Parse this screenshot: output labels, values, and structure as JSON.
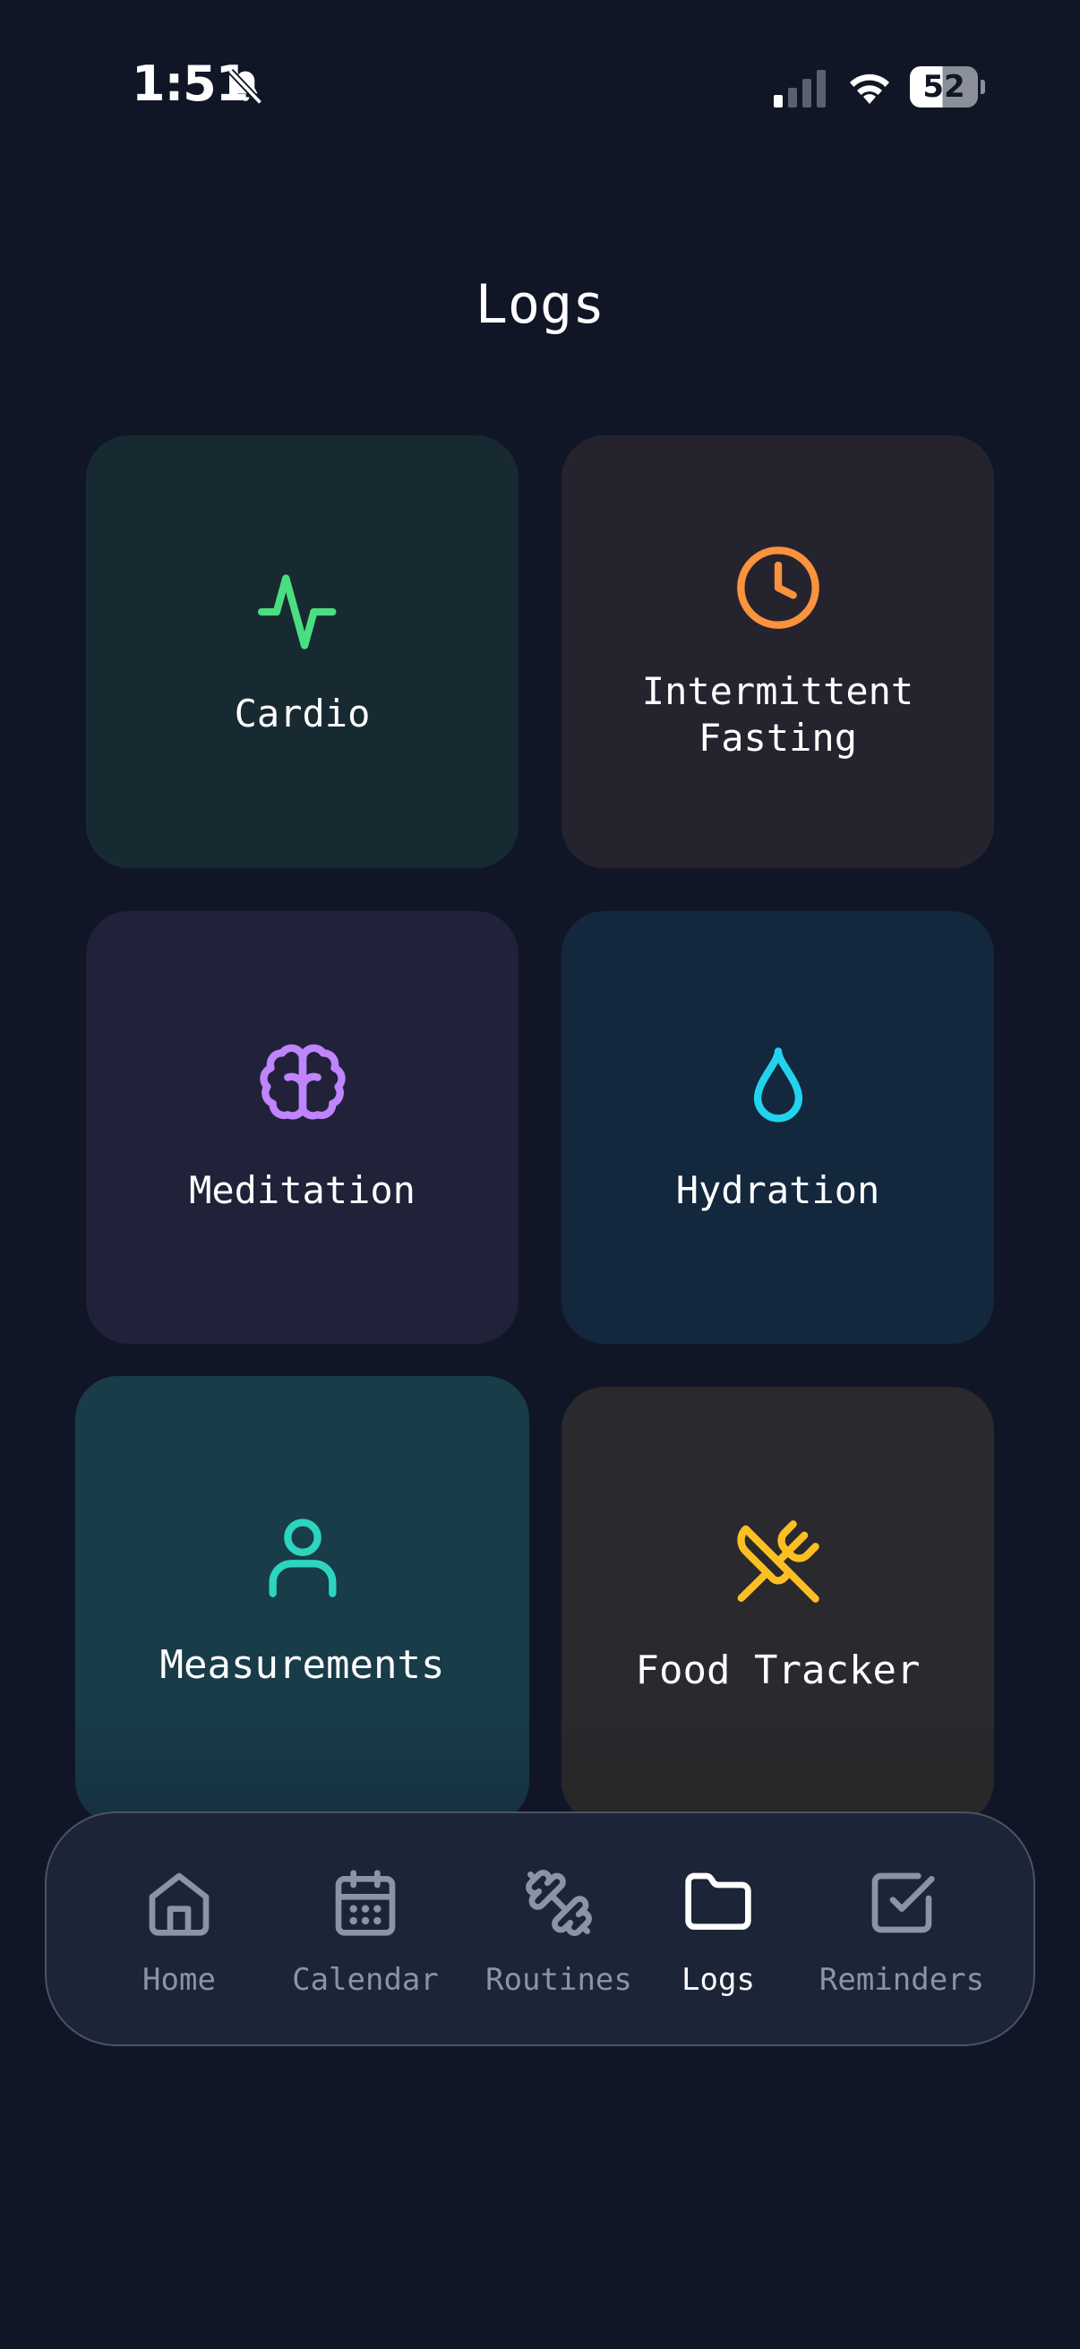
{
  "status_bar": {
    "time": "1:51",
    "battery_percent": "52",
    "battery_level": 0.52,
    "signal_bars_active": 1,
    "signal_bars_total": 4,
    "icons": [
      "bell-slash-icon",
      "cellular-signal-icon",
      "wifi-icon",
      "battery-icon"
    ]
  },
  "page": {
    "title": "Logs"
  },
  "tiles": [
    {
      "label": "Cardio",
      "icon": "activity-pulse-icon",
      "color": "#4ade80"
    },
    {
      "label": "Intermittent\nFasting",
      "icon": "clock-icon",
      "color": "#fb923c"
    },
    {
      "label": "Meditation",
      "icon": "brain-icon",
      "color": "#c084fc"
    },
    {
      "label": "Hydration",
      "icon": "droplet-icon",
      "color": "#22d3ee"
    },
    {
      "label": "Measurements",
      "icon": "user-icon",
      "color": "#2dd4bf"
    },
    {
      "label": "Food Tracker",
      "icon": "utensils-crossed-icon",
      "color": "#fbbf24"
    }
  ],
  "nav": {
    "active": "Logs",
    "items": [
      {
        "label": "Home",
        "icon": "home-icon"
      },
      {
        "label": "Calendar",
        "icon": "calendar-icon"
      },
      {
        "label": "Routines",
        "icon": "dumbbell-icon"
      },
      {
        "label": "Logs",
        "icon": "folder-icon"
      },
      {
        "label": "Reminders",
        "icon": "checkbox-icon"
      }
    ]
  },
  "colors": {
    "background": "#111627",
    "nav_inactive": "#8b93a6",
    "nav_active": "#ffffff"
  }
}
